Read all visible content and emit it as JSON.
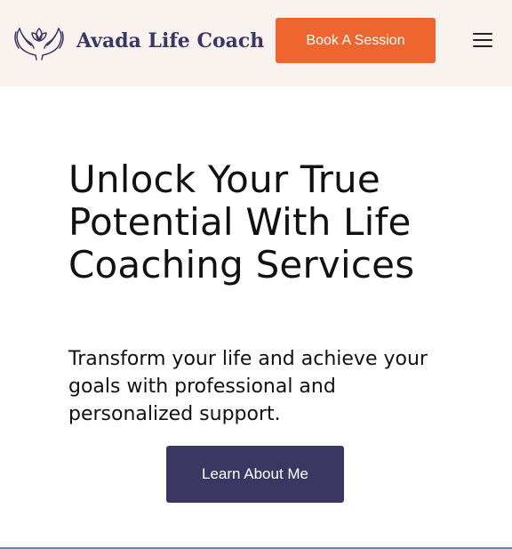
{
  "header": {
    "brand_name": "Avada Life Coach",
    "logo_icon": "hands-lotus-icon",
    "cta_label": "Book A Session",
    "menu_icon": "hamburger-menu-icon"
  },
  "hero": {
    "title": "Unlock Your True Potential With Life Coaching Services",
    "subtitle": "Transform your life and achieve your goals with professional and personalized support.",
    "button_label": "Learn About Me"
  },
  "colors": {
    "header_bg": "#faf2ef",
    "brand": "#3a3763",
    "accent": "#ef6530",
    "divider": "#2d9ad6"
  }
}
